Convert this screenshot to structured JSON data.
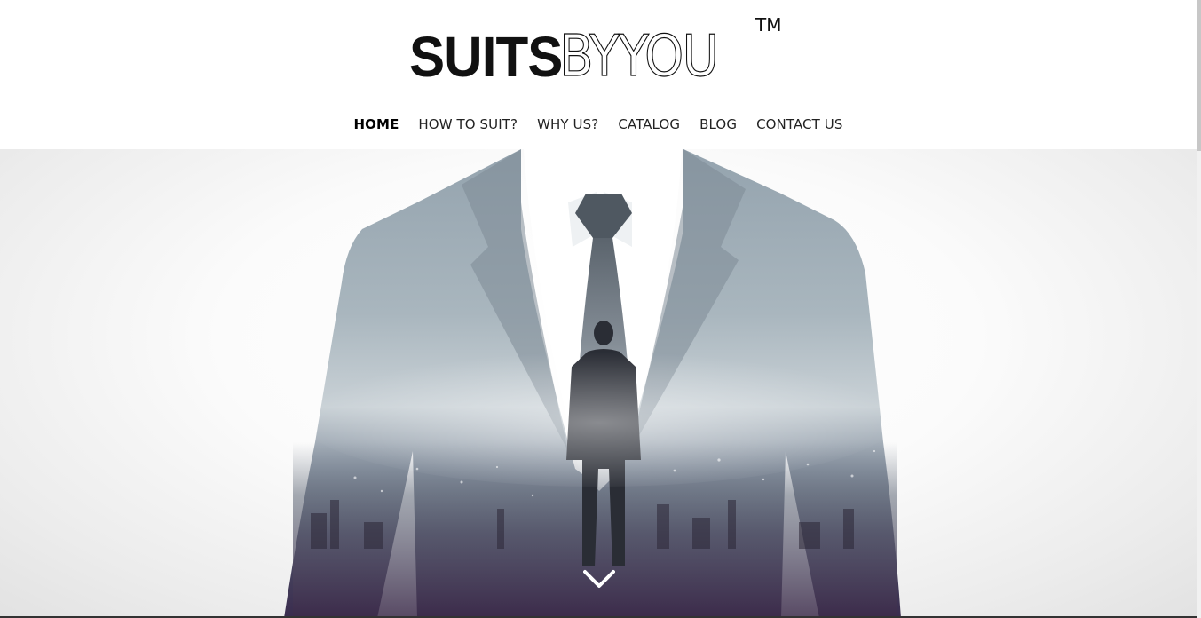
{
  "brand": {
    "name_bold": "SUITS",
    "name_light": "BYYOU",
    "trademark": "TM"
  },
  "nav": {
    "items": [
      {
        "label": "HOME",
        "active": true
      },
      {
        "label": "HOW TO SUIT?",
        "active": false
      },
      {
        "label": "WHY US?",
        "active": false
      },
      {
        "label": "CATALOG",
        "active": false
      },
      {
        "label": "BLOG",
        "active": false
      },
      {
        "label": "CONTACT US",
        "active": false
      }
    ]
  },
  "hero": {
    "image": "suit-double-exposure-city-man",
    "scroll_icon": "chevron-down-icon"
  },
  "colors": {
    "text": "#111111",
    "suit": "#8796a2",
    "suit_dark": "#3b3f55",
    "city_purple": "#5a3d6a",
    "background": "#ffffff"
  }
}
